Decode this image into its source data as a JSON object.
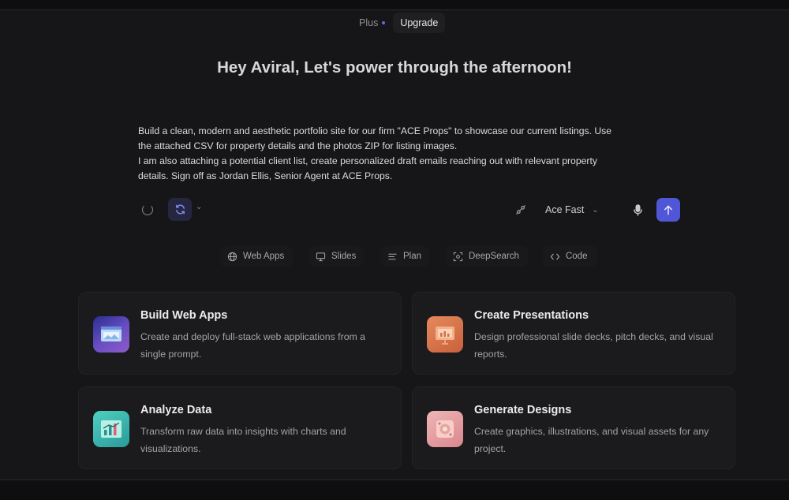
{
  "header": {
    "plan": "Plus",
    "upgrade_label": "Upgrade"
  },
  "greeting": "Hey Aviral, Let's power through the afternoon!",
  "prompt": {
    "line1": "Build a clean, modern and aesthetic portfolio site for our firm \"ACE Props\" to showcase our current listings. Use",
    "line2": "the attached CSV for property details and the photos ZIP for listing images.",
    "line3": "I am also attaching a potential client list, create personalized draft emails reaching out with relevant property",
    "line4": "details. Sign off as Jordan Ellis, Senior Agent at ACE Props."
  },
  "toolbar": {
    "model": "Ace Fast"
  },
  "modes": [
    {
      "label": "Web Apps",
      "icon": "globe-icon"
    },
    {
      "label": "Slides",
      "icon": "presentation-icon"
    },
    {
      "label": "Plan",
      "icon": "list-icon"
    },
    {
      "label": "DeepSearch",
      "icon": "scan-icon"
    },
    {
      "label": "Code",
      "icon": "code-icon"
    }
  ],
  "cards": [
    {
      "title": "Build Web Apps",
      "description": "Create and deploy full-stack web applications from a single prompt.",
      "icon": "web-app-icon"
    },
    {
      "title": "Create Presentations",
      "description": "Design professional slide decks, pitch decks, and visual reports.",
      "icon": "presentation-icon"
    },
    {
      "title": "Analyze Data",
      "description": "Transform raw data into insights with charts and visualizations.",
      "icon": "chart-icon"
    },
    {
      "title": "Generate Designs",
      "description": "Create graphics, illustrations, and visual assets for any project.",
      "icon": "design-icon"
    }
  ],
  "colors": {
    "accent": "#4f57d6",
    "background": "#161618",
    "card": "#1b1b1e"
  }
}
